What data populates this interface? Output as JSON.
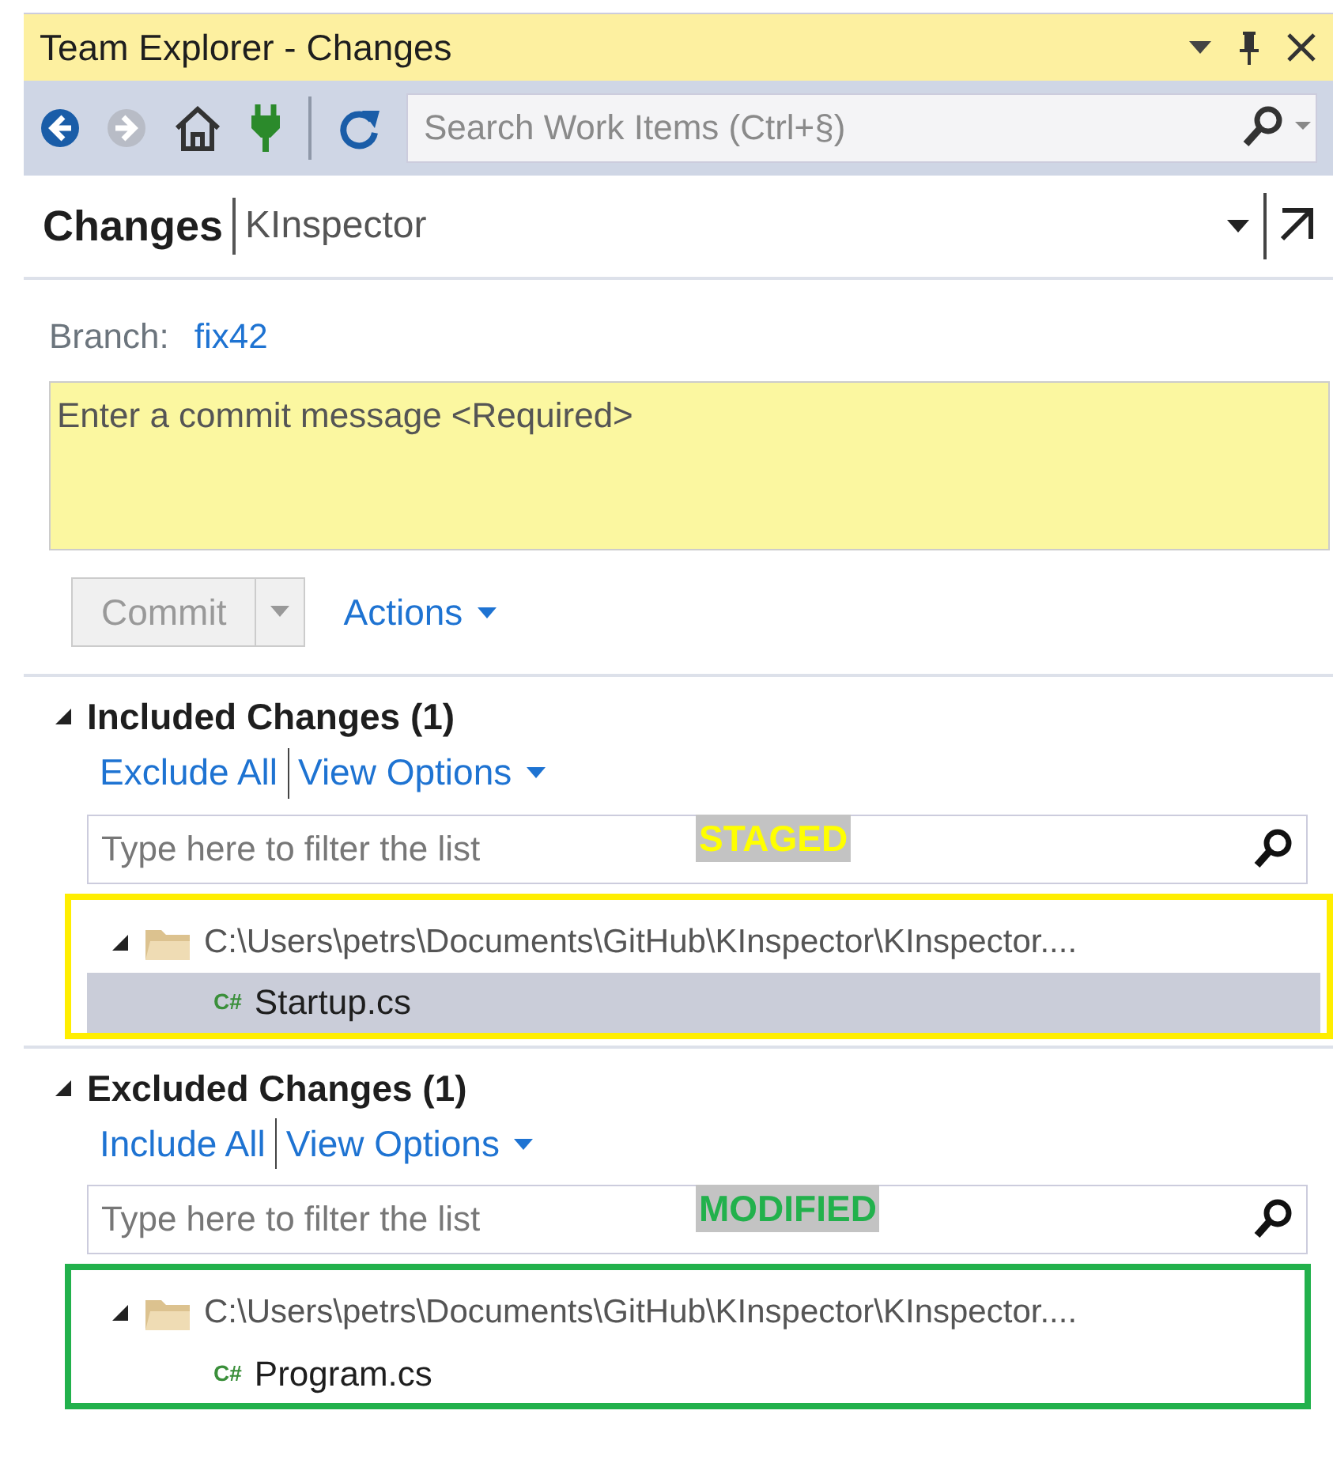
{
  "window": {
    "title": "Team Explorer - Changes"
  },
  "toolbar": {
    "buttons": [
      {
        "kind": "back",
        "disabled": false
      },
      {
        "kind": "forward",
        "disabled": true
      },
      {
        "kind": "home",
        "disabled": false
      },
      {
        "kind": "connect",
        "disabled": false
      },
      {
        "kind": "refresh",
        "disabled": false
      }
    ],
    "search": {
      "placeholder": "Search Work Items (Ctrl+§)"
    }
  },
  "header": {
    "title": "Changes",
    "subtitle": "KInspector"
  },
  "branch": {
    "label": "Branch:",
    "value": "fix42"
  },
  "commit_message": {
    "placeholder": "Enter a commit message <Required>"
  },
  "commit_button": {
    "label": "Commit",
    "disabled": true
  },
  "actions_link": {
    "label": "Actions"
  },
  "sections": [
    {
      "title": "Included Changes (1)",
      "expanded": true,
      "toggle_link": "Exclude All",
      "options_link": "View Options",
      "filter": {
        "placeholder": "Type here to filter the list"
      },
      "annotation": {
        "text": "STAGED",
        "color": "#ffff00"
      },
      "frame": {
        "color": "#ffee00"
      },
      "folder": {
        "path": "C:\\Users\\petrs\\Documents\\GitHub\\KInspector\\KInspector....",
        "expanded": true,
        "files": [
          {
            "badge": "C#",
            "name": "Startup.cs",
            "selected": true
          }
        ]
      }
    },
    {
      "title": "Excluded Changes (1)",
      "expanded": true,
      "toggle_link": "Include All",
      "options_link": "View Options",
      "filter": {
        "placeholder": "Type here to filter the list"
      },
      "annotation": {
        "text": "MODIFIED",
        "color": "#22b14c"
      },
      "frame": {
        "color": "#22b14c"
      },
      "folder": {
        "path": "C:\\Users\\petrs\\Documents\\GitHub\\KInspector\\KInspector....",
        "expanded": true,
        "files": [
          {
            "badge": "C#",
            "name": "Program.cs",
            "selected": false
          }
        ]
      }
    }
  ]
}
